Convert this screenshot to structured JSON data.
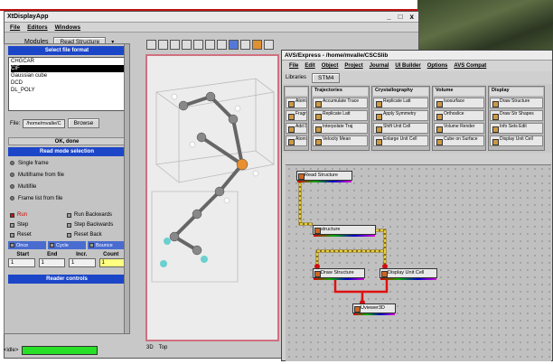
{
  "main": {
    "title": "XtDisplayApp",
    "window_controls": [
      "_",
      "□",
      "x"
    ],
    "menu": [
      "File",
      "Editors",
      "Windows"
    ],
    "modules_label": "Modules",
    "module_select": "Read Structure"
  },
  "left": {
    "select_format_label": "Select file format",
    "formats": [
      "CHGCAR",
      "CIF",
      "Gaussian cube",
      "DCD",
      "DL_POLY"
    ],
    "selected_format": "CIF",
    "file_label": "File:",
    "file_path": "/home/mvalle/C",
    "browse_label": "Browse",
    "ok_label": "OK, done",
    "read_mode_label": "Read mode selection",
    "modes": [
      "Single frame",
      "Multiframe from file",
      "Multifile",
      "Frame list from file"
    ],
    "controls": [
      "Run",
      "Run Backwards",
      "Step",
      "Step Backwards",
      "Reset",
      "Reset Back"
    ],
    "loop_modes": [
      "Once",
      "Cycle",
      "Bounce"
    ],
    "range_headers": [
      "Start",
      "End",
      "Incr.",
      "Count"
    ],
    "range_values": [
      "1",
      "1",
      "1",
      "1"
    ],
    "reader_controls_label": "Reader controls",
    "status_text": "<idle>"
  },
  "viewer": {
    "tabs": [
      "3D",
      "Top"
    ]
  },
  "aws": {
    "title": "AVS/Express - /home/mvalle/CSCSlib",
    "menu": [
      "File",
      "Edit",
      "Object",
      "Project",
      "Journal",
      "UI Builder",
      "Options",
      "AVS Compat"
    ],
    "libraries_label": "Libraries",
    "library_select": "STM4",
    "columns": [
      {
        "title": "Trajectories",
        "modules": [
          "Accumulate Trace",
          "Replicate Latt",
          "Interpolate Traj",
          "Velocity Mean"
        ]
      },
      {
        "title": "Crystallography",
        "modules": [
          "Replicate Latt",
          "Apply Symmetry",
          "Shift Unit Cell",
          "Enlarge Unit Cell"
        ]
      },
      {
        "title": "Volume",
        "modules": [
          "Isosurface",
          "Orthoslice",
          "Volume Render",
          "Cube on Surface"
        ]
      },
      {
        "title": "Display",
        "modules": [
          "Draw Structure",
          "Draw Str Shapes",
          "Info Sets Edit",
          "Display Unit Cell"
        ]
      }
    ],
    "side_items": [
      "Atoms",
      "Fragments",
      "Add Data",
      "Atoms"
    ],
    "network_nodes": {
      "read": "Read Structure",
      "structure": "structure",
      "draw": "Draw Structure",
      "unitcell": "Display Unit Cell",
      "viewer": "Uviewer3D"
    }
  }
}
